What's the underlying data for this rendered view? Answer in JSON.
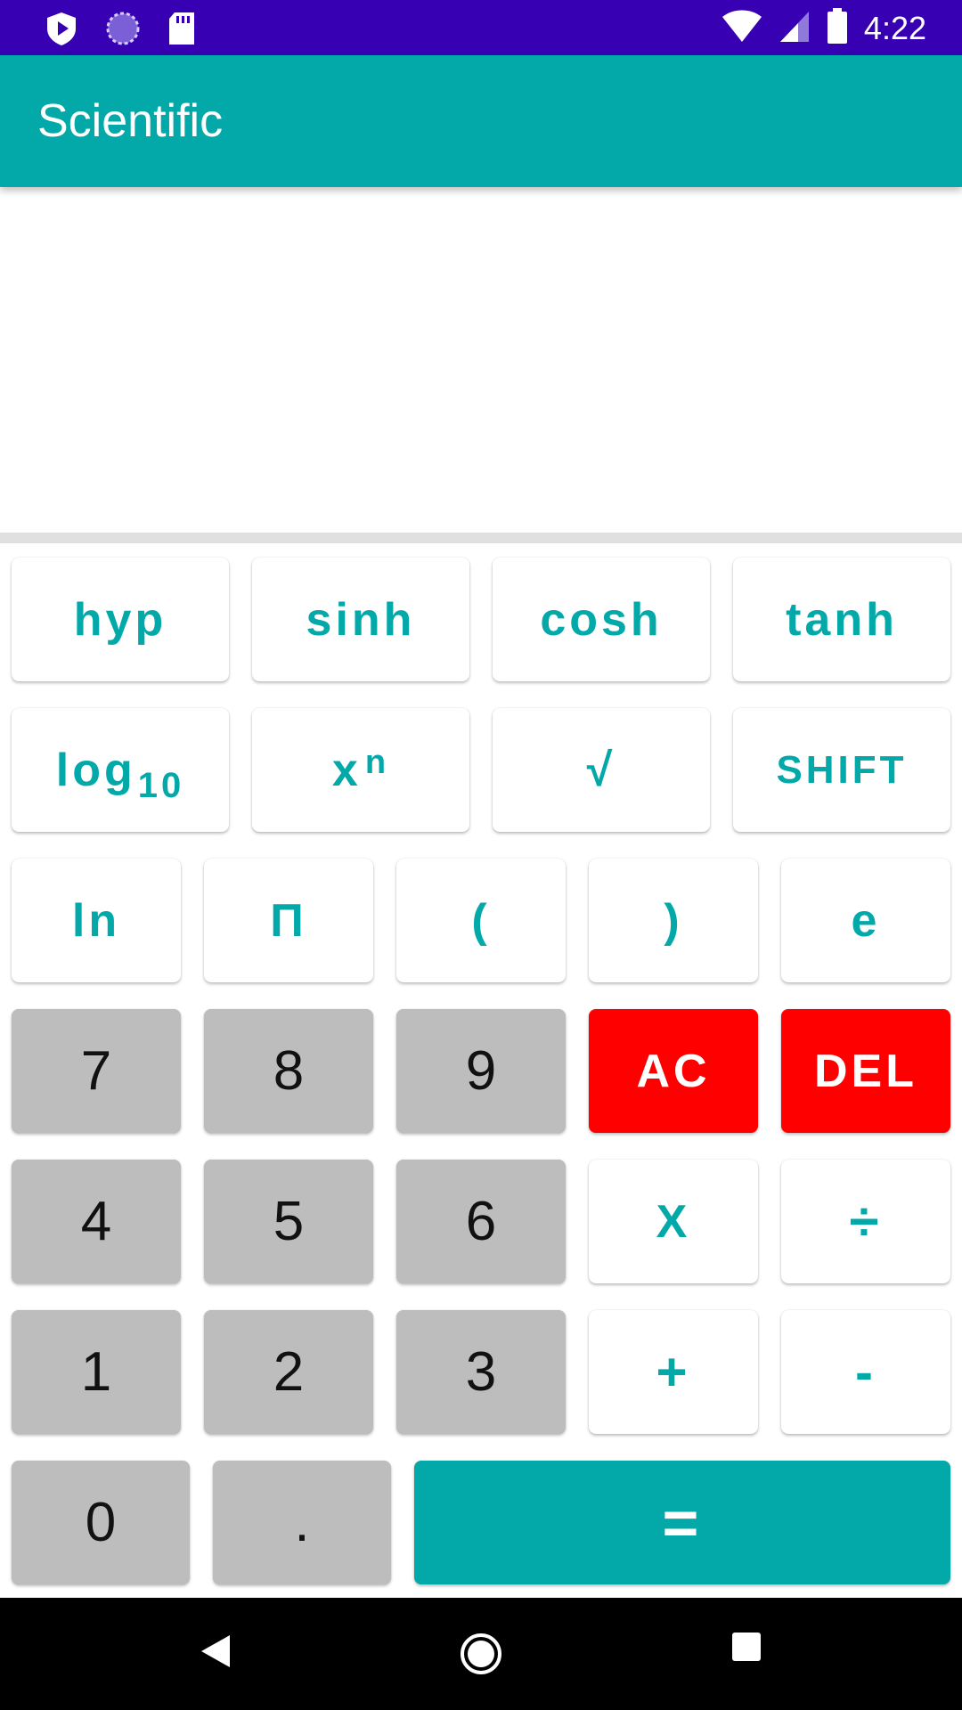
{
  "status_bar": {
    "time": "4:22",
    "left_icons": [
      "play-protect-icon",
      "sync-circle-icon",
      "sd-card-icon"
    ],
    "right_icons": [
      "wifi-icon",
      "signal-icon",
      "battery-icon"
    ]
  },
  "app_bar": {
    "title": "Scientific"
  },
  "display": {
    "value": ""
  },
  "keys": {
    "hyp": "hyp",
    "sinh": "sinh",
    "cosh": "cosh",
    "tanh": "tanh",
    "log_base": "log",
    "log_sub": "10",
    "pow_base": "x",
    "pow_sup": "n",
    "sqrt": "√",
    "shift": "SHIFT",
    "ln": "ln",
    "pi": "Π",
    "lparen": "(",
    "rparen": ")",
    "e": "e",
    "seven": "7",
    "eight": "8",
    "nine": "9",
    "ac": "AC",
    "del": "DEL",
    "four": "4",
    "five": "5",
    "six": "6",
    "multiply": "X",
    "divide": "÷",
    "one": "1",
    "two": "2",
    "three": "3",
    "plus": "+",
    "minus": "-",
    "zero": "0",
    "dot": ".",
    "equals": "="
  },
  "colors": {
    "accent": "#03a9a9",
    "status_bar": "#3700b3",
    "danger": "#ff0000",
    "number_key": "#bdbdbd"
  },
  "nav_bar": {
    "icons": [
      "back-icon",
      "home-icon",
      "recents-icon"
    ]
  }
}
